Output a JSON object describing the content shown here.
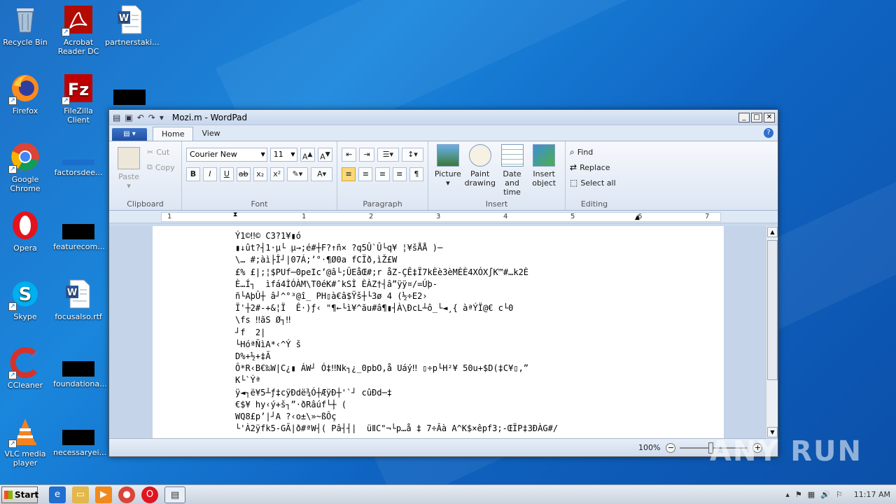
{
  "desktop": {
    "icons": [
      {
        "label": "Recycle Bin",
        "icon": "recycle-bin-icon"
      },
      {
        "label": "Acrobat Reader DC",
        "icon": "acrobat-icon"
      },
      {
        "label": "partnerstaki...",
        "icon": "word-doc-icon"
      },
      {
        "label": "Firefox",
        "icon": "firefox-icon"
      },
      {
        "label": "FileZilla Client",
        "icon": "filezilla-icon"
      },
      {
        "label": "Google Chrome",
        "icon": "chrome-icon"
      },
      {
        "label": "factorsdee...",
        "icon": "file-icon"
      },
      {
        "label": "Opera",
        "icon": "opera-icon"
      },
      {
        "label": "featurecom...",
        "icon": "file-icon"
      },
      {
        "label": "Skype",
        "icon": "skype-icon"
      },
      {
        "label": "focusalso.rtf",
        "icon": "word-doc-icon"
      },
      {
        "label": "CCleaner",
        "icon": "ccleaner-icon"
      },
      {
        "label": "foundationa...",
        "icon": "file-icon"
      },
      {
        "label": "VLC media player",
        "icon": "vlc-icon"
      },
      {
        "label": "necessaryei...",
        "icon": "file-icon"
      }
    ]
  },
  "window": {
    "title": "Mozi.m - WordPad",
    "tabs": [
      "Home",
      "View"
    ],
    "clipboard": {
      "paste": "Paste",
      "cut": "Cut",
      "copy": "Copy",
      "label": "Clipboard"
    },
    "font": {
      "family": "Courier New",
      "size": "11",
      "label": "Font"
    },
    "paragraph": {
      "label": "Paragraph"
    },
    "insert": {
      "label": "Insert",
      "picture": "Picture",
      "paint": "Paint drawing",
      "datetime": "Date and time",
      "object": "Insert object"
    },
    "editing": {
      "label": "Editing",
      "find": "Find",
      "replace": "Replace",
      "select_all": "Select all"
    },
    "ruler_numbers": [
      "1",
      "1",
      "2",
      "3",
      "4",
      "5",
      "6",
      "7"
    ],
    "document_text": "Ý1©‼© C3?1¥▮ó\n▮↓ût?┤1·µ└ µ→;é#┼F?↑ñ× ?q5Û`Û└q¥ ¦¥šÅÅ )─\n\\… #;àì├Î┘|07Á;’°·¶Ø0a fCÏð,ìŽ£W\n£% £|;¦$PUf─0peIc’@â└;ÛEåŒ#;r åZ-ÇÊ‡Ï7kÈè3èMÈÈ4XÓX∫K™#…k2È\nÈ…Í┐  ìfá4ÌÓÀM\\T0éK#ˆkSÌ ÈÀZ†┤â”ÿÿ¤/=Úþ-\nñ└AþÛ┼ â┘^°³@î_ PH▯à€â$Ÿš┼└3ø 4 (½÷E2›\nÏ'┼2#-+&¦Ï  Ê·)ƒ‹ \"¶←└ì¥^ãu#â¶▮┤À\\ÐcL┴ô_└◄¸{ àªÝÏ@€ c└0\n\\fs ‼ãS Ø┐‼\n┘f  2|\n└HóªÑìA*‹^Ý š\nD%+½+‡Ã\nÔ*R‹B€‰W|C¿▮ ÁW┘ Ó‡‼Nk┐¿_0pbO,å Uáý‼ ▯÷p└H²¥ 50u+$D(‡C¥▯,”\nK└`Ýª\nÿ◄┐ë¥5┴ƒ‡cÿÐdë¾Ó┼ÆÿÐ┼'`┘ cûÐd─‡\n€$¥ hy‹ý+š┐”·ðRâúf└┼ (\nWQ8£p’|┘A ?‹o±\\»~ßÔç\n└'À2ÿfk5-GÃ|ð#ªW┤( Pâ┤┤|  üⅡC\"¬└p…å ‡ 7÷Âà A^K$×êpf3;-ŒÏP‡3ÐÀG#/",
    "zoom": "100%",
    "zoom_fraction": 0.45
  },
  "taskbar": {
    "start": "Start",
    "clock": "11:17 AM"
  },
  "watermark": "ANY RUN",
  "colors": {
    "desktop": "#1a86dc",
    "accent": "#2d6fd0"
  }
}
